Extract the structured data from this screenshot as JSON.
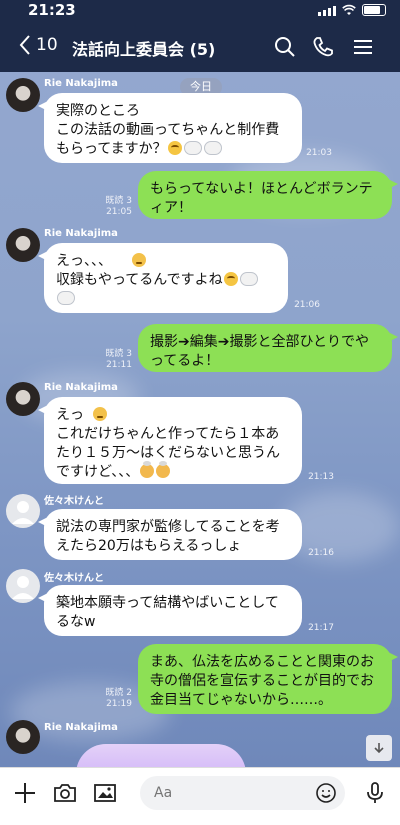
{
  "status": {
    "time": "21:23"
  },
  "header": {
    "back_count": "10",
    "title": "法話向上委員会 (5)"
  },
  "chat": {
    "date": "今日",
    "messages": [
      {
        "side": "in",
        "sender": "Rie Nakajima",
        "avatar": "rie",
        "text": "実際のところ\nこの法話の動画ってちゃんと制作費\nもらってますか？",
        "emojis": [
          "think",
          "puff",
          "puff"
        ],
        "time": "21:03"
      },
      {
        "side": "out",
        "text": "もらってないよ！ほとんどボランテ\nィア！",
        "read": "既読 3",
        "time": "21:05"
      },
      {
        "side": "in",
        "sender": "Rie Nakajima",
        "avatar": "rie",
        "text": "えっ、、、\n収録もやってるんですよね",
        "emojis_line1": [
          "hush"
        ],
        "emojis": [
          "think",
          "puff",
          "puff"
        ],
        "time": "21:06"
      },
      {
        "side": "out",
        "text": "撮影➔編集➔撮影と全部ひとりでや\nってるよ！",
        "read": "既読 3",
        "time": "21:11"
      },
      {
        "side": "in",
        "sender": "Rie Nakajima",
        "avatar": "rie",
        "text": "えっ\nこれだけちゃんと作ってたら１本あ\nたり１５万〜はくだらないと思うん\nですけど、、、",
        "emojis_line1": [
          "hush"
        ],
        "emojis": [
          "mind",
          "mind"
        ],
        "time": "21:13"
      },
      {
        "side": "in",
        "sender": "佐々木けんと",
        "avatar": "sasaki",
        "text": "説法の専門家が監修してることを考\nえたら20万はもらえるっしょ",
        "time": "21:16"
      },
      {
        "side": "in",
        "sender": "佐々木けんと",
        "avatar": "sasaki",
        "text": "築地本願寺って結構やばいことして\nるなw",
        "time": "21:17"
      },
      {
        "side": "out",
        "text": "まあ、仏法を広めることと関東のお\n寺の僧侶を宣伝することが目的でお\n金目当てじゃないから……。",
        "read": "既読 2",
        "time": "21:19"
      },
      {
        "side": "in",
        "sender": "Rie Nakajima",
        "avatar": "rie"
      }
    ]
  },
  "input": {
    "placeholder": "Aa"
  },
  "icons": [
    "back-chevron-icon",
    "search-icon",
    "phone-icon",
    "menu-icon",
    "plus-icon",
    "camera-icon",
    "image-icon",
    "smile-icon",
    "mic-icon",
    "scroll-down-icon"
  ]
}
